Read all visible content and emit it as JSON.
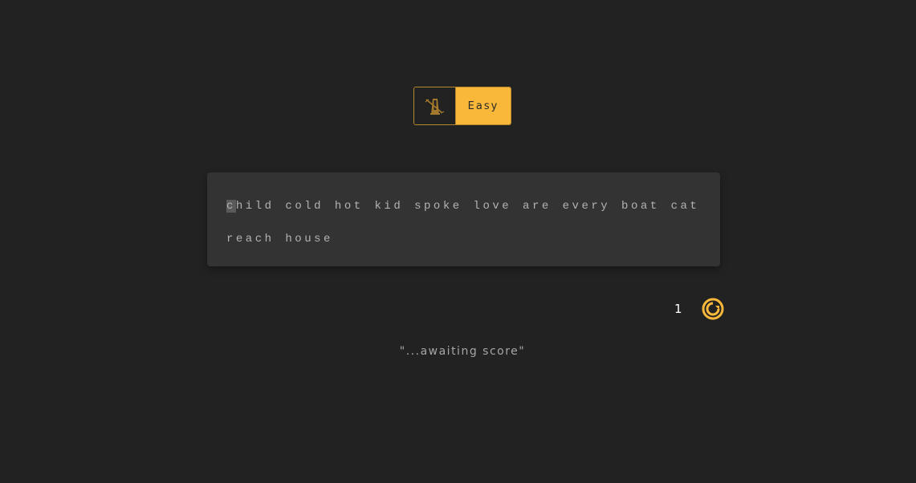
{
  "mode": {
    "icon": "metronome-icon",
    "label": "Easy"
  },
  "typing_text": {
    "cursor_char": "c",
    "line1_rest": "hild cold hot kid spoke love are every boat cat",
    "line2": "reach house"
  },
  "stats": {
    "count": "1",
    "restart_icon": "restart-icon"
  },
  "score_status": "\"...awaiting score\"",
  "colors": {
    "background": "#222222",
    "panel": "#333333",
    "accent": "#f9b83a",
    "accent_border": "#b8892a",
    "text_muted": "#b3b3b3"
  }
}
